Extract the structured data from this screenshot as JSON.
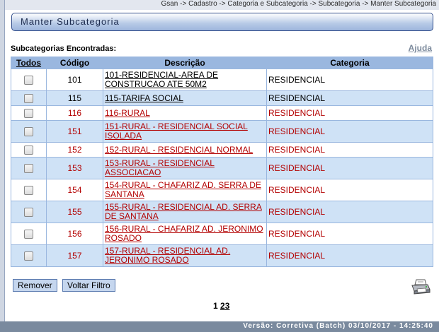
{
  "breadcrumb": "Gsan -> Cadastro -> Categoria e Subcategoria -> Subcategoria -> Manter Subcategoria",
  "page_title": "Manter Subcategoria",
  "found_label": "Subcategorias Encontradas:",
  "help_link": "Ajuda",
  "table": {
    "headers": {
      "todos": "Todos",
      "codigo": "Código",
      "descricao": "Descrição",
      "categoria": "Categoria"
    },
    "rows": [
      {
        "codigo": "101",
        "descricao": "101-RESIDENCIAL-AREA DE CONSTRUCAO ATE 50M2",
        "categoria": "RESIDENCIAL",
        "color": "#000000"
      },
      {
        "codigo": "115",
        "descricao": "115-TARIFA SOCIAL",
        "categoria": "RESIDENCIAL",
        "color": "#000000"
      },
      {
        "codigo": "116",
        "descricao": "116-RURAL",
        "categoria": "RESIDENCIAL",
        "color": "#b30000"
      },
      {
        "codigo": "151",
        "descricao": "151-RURAL - RESIDENCIAL SOCIAL ISOLADA",
        "categoria": "RESIDENCIAL",
        "color": "#b30000"
      },
      {
        "codigo": "152",
        "descricao": "152-RURAL - RESIDENCIAL NORMAL",
        "categoria": "RESIDENCIAL",
        "color": "#b30000"
      },
      {
        "codigo": "153",
        "descricao": "153-RURAL - RESIDENCIAL ASSOCIACAO",
        "categoria": "RESIDENCIAL",
        "color": "#b30000"
      },
      {
        "codigo": "154",
        "descricao": "154-RURAL - CHAFARIZ AD. SERRA DE SANTANA",
        "categoria": "RESIDENCIAL",
        "color": "#b30000"
      },
      {
        "codigo": "155",
        "descricao": "155-RURAL - RESIDENCIAL AD. SERRA DE SANTANA",
        "categoria": "RESIDENCIAL",
        "color": "#b30000"
      },
      {
        "codigo": "156",
        "descricao": "156-RURAL - CHAFARIZ AD. JERONIMO ROSADO",
        "categoria": "RESIDENCIAL",
        "color": "#b30000"
      },
      {
        "codigo": "157",
        "descricao": "157-RURAL - RESIDENCIAL AD. JERONIMO ROSADO",
        "categoria": "RESIDENCIAL",
        "color": "#b30000"
      }
    ]
  },
  "buttons": {
    "remover": "Remover",
    "voltar_filtro": "Voltar Filtro"
  },
  "print_icon": "printer-icon",
  "pagination": {
    "current": "1",
    "pages": [
      "2",
      "3"
    ]
  },
  "footer": "Versão: Corretiva (Batch) 03/10/2017 - 14:25:40",
  "colors": {
    "header_row": "#9ab7df",
    "row_stripe": "#cfe2f6",
    "inactive_text": "#b30000",
    "footer_bg": "#7a8a9e"
  }
}
